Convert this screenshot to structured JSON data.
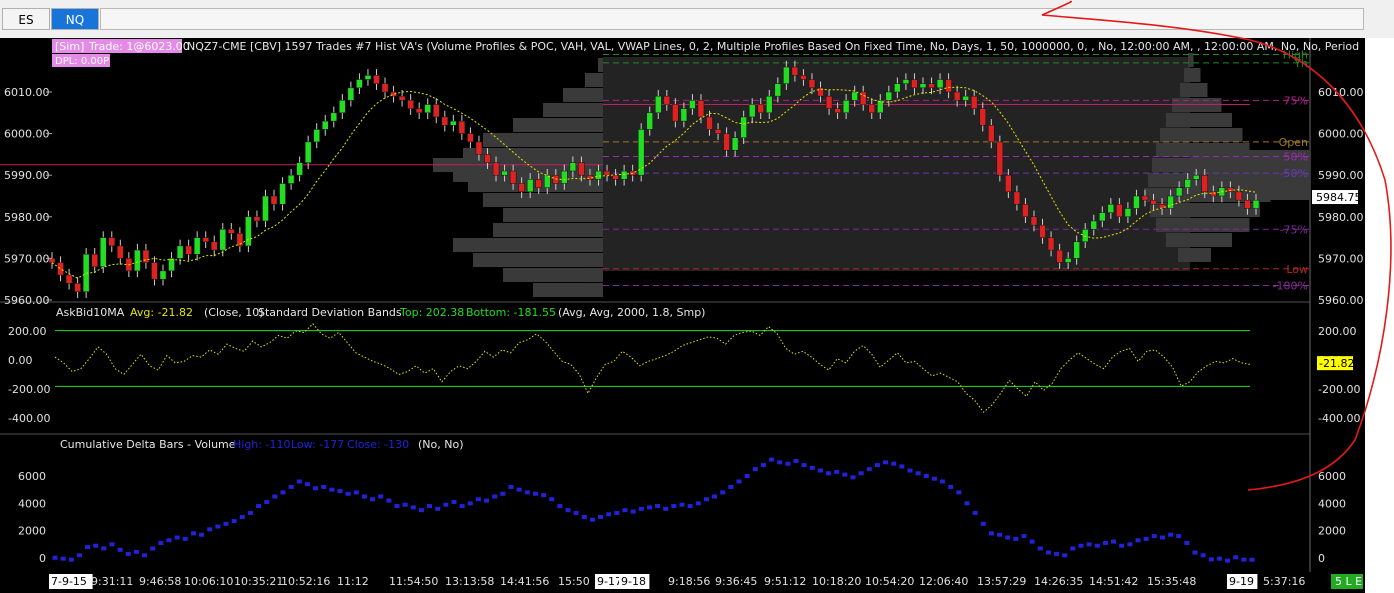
{
  "tabs": [
    {
      "label": "ES",
      "active": false
    },
    {
      "label": "NQ",
      "active": true
    }
  ],
  "colors": {
    "background": "#000000",
    "up": "#22dd22",
    "down": "#dd2222",
    "profile": "#3a3a3a",
    "vwap": "#e6e600",
    "askbid": "#e6e600",
    "bands": "#22dd22",
    "delta": "#2222dd",
    "annotation": "#e41a1a",
    "text": "#e0e0e0"
  },
  "header": {
    "sim_label": "[Sim]",
    "trade_label": "Trade: 1@6023.00",
    "info": "NQZ7-CME [CBV]  1597 Trades  #7 Hist VA's   (Volume Profiles & POC, VAH, VAL, VWAP Lines, 0, 2, Multiple Profiles Based On Fixed Time, No, Days, 1, 50, 1000000, 0, , No, 12:00:00 AM, , 12:00:00 AM, No, No, Period",
    "dpl_label": "DPL: 0.00P"
  },
  "price_panel": {
    "axis_labels": [
      "6010.00",
      "6000.00",
      "5990.00",
      "5980.00",
      "5970.00",
      "5960.00"
    ],
    "axis_values": [
      6010,
      6000,
      5990,
      5980,
      5970,
      5960
    ],
    "last_price": "5984.75",
    "level_labels": [
      {
        "text": "High",
        "value": 6019,
        "color": "#1e8c1e"
      },
      {
        "text": "Yh",
        "value": 6017,
        "color": "#1e8c1e"
      },
      {
        "text": "75%",
        "value": 6008,
        "color": "#b0208c"
      },
      {
        "text": "Open",
        "value": 5998,
        "color": "#a07828"
      },
      {
        "text": "50%",
        "value": 5994.5,
        "color": "#9a2ab0"
      },
      {
        "text": "-50%",
        "value": 5990.5,
        "color": "#6a3ab0"
      },
      {
        "text": "-75%",
        "value": 5977,
        "color": "#7a2a9a"
      },
      {
        "text": "Low",
        "value": 5967.5,
        "color": "#b02828"
      },
      {
        "text": "-100%",
        "value": 5963.5,
        "color": "#8a2a9a"
      }
    ]
  },
  "askbid_panel": {
    "name": "AskBid10MA",
    "avg_label": "Avg: -21.82",
    "params_a": "(Close, 10)",
    "bands_name": "Standard Deviation Bands",
    "top_label": "Top: 202.38",
    "bottom_label": "Bottom: -181.55",
    "params_b": "(Avg, Avg, 2000, 1.8, Smp)",
    "axis_labels": [
      "200.00",
      "0.00",
      "-200.00",
      "-400.00"
    ],
    "axis_values": [
      200,
      0,
      -200,
      -400
    ],
    "current_label": "-21.82",
    "current_value": -21.82,
    "top_value": 202.38,
    "bottom_value": -181.55
  },
  "delta_panel": {
    "name": "Cumulative Delta Bars - Volume",
    "high_label": "High: -110",
    "low_label": "Low: -177",
    "close_label": "Close: -130",
    "params": "(No, No)",
    "axis_labels": [
      "6000",
      "4000",
      "2000",
      "0"
    ],
    "axis_values": [
      6000,
      4000,
      2000,
      0
    ]
  },
  "time_axis": {
    "labels": [
      "7-9-15",
      "9:31:11",
      "9:46:58",
      "10:06:10",
      "10:35:21",
      "10:52:16",
      "11:12",
      "11:54:50",
      "13:13:58",
      "14:41:56",
      "15:50",
      "9-17",
      "9-18",
      "9:18:56",
      "9:36:45",
      "9:51:12",
      "10:18:20",
      "10:54:20",
      "12:06:40",
      "13:57:29",
      "14:26:35",
      "14:51:42",
      "15:35:48",
      "9-19",
      "5:37:16"
    ],
    "boxed": [
      "7-9-15",
      "9-17",
      "9-18",
      "9-19"
    ]
  },
  "status_badge": "5 L E",
  "chart_data": {
    "type": "candlestick",
    "price_series": {
      "name": "NQZ7-CME",
      "close": [
        5969,
        5966,
        5964,
        5962,
        5971,
        5968,
        5975,
        5973,
        5970,
        5967,
        5972,
        5969,
        5965,
        5967,
        5970,
        5973,
        5971,
        5975,
        5974,
        5972,
        5977,
        5976,
        5973,
        5980,
        5979,
        5985,
        5983,
        5988,
        5990,
        5993,
        5998,
        6001,
        6003,
        6005,
        6008,
        6011,
        6013,
        6014,
        6012,
        6010,
        6009,
        6008,
        6006,
        6005,
        6007,
        6004,
        6002,
        6003,
        6000,
        5998,
        5995,
        5993,
        5990,
        5991,
        5988,
        5986,
        5989,
        5987,
        5990,
        5988,
        5991,
        5993,
        5990,
        5989,
        5991,
        5990,
        5989,
        5991,
        5990,
        6001,
        6005,
        6009,
        6007,
        6003,
        6006,
        6008,
        6004,
        6001,
        6000,
        5996,
        5999,
        6004,
        6007,
        6005,
        6009,
        6012,
        6016,
        6014,
        6013,
        6011,
        6009,
        6006,
        6005,
        6008,
        6010,
        6007,
        6005,
        6008,
        6010,
        6012,
        6013,
        6011,
        6012,
        6011,
        6013,
        6010,
        6008,
        6009,
        6006,
        6002,
        5998,
        5990,
        5986,
        5983,
        5980,
        5978,
        5975,
        5972,
        5969,
        5970,
        5974,
        5977,
        5979,
        5981,
        5983,
        5980,
        5982,
        5985,
        5984,
        5983,
        5982,
        5985,
        5987,
        5989,
        5990,
        5986,
        5985,
        5987,
        5986,
        5984,
        5982,
        5984
      ]
    },
    "askbid_series": {
      "name": "AskBid10MA",
      "values": [
        20,
        -20,
        -80,
        -60,
        10,
        90,
        40,
        -60,
        -100,
        -30,
        40,
        -40,
        -70,
        30,
        -20,
        -10,
        30,
        20,
        70,
        40,
        110,
        80,
        60,
        130,
        90,
        120,
        170,
        150,
        200,
        190,
        250,
        180,
        150,
        190,
        120,
        50,
        20,
        -10,
        -30,
        -60,
        -100,
        -80,
        -40,
        -90,
        -60,
        -150,
        -80,
        -40,
        -60,
        -10,
        60,
        20,
        70,
        50,
        120,
        140,
        180,
        130,
        60,
        -10,
        -30,
        -100,
        -230,
        -120,
        -30,
        -10,
        60,
        20,
        -40,
        -10,
        10,
        30,
        60,
        100,
        120,
        140,
        160,
        150,
        110,
        170,
        190,
        200,
        170,
        230,
        180,
        80,
        40,
        60,
        20,
        -30,
        -70,
        10,
        -20,
        60,
        100,
        40,
        -50,
        0,
        50,
        -20,
        -10,
        -60,
        -110,
        -90,
        -120,
        -150,
        -230,
        -280,
        -360,
        -310,
        -230,
        -140,
        -200,
        -250,
        -150,
        -210,
        -160,
        -60,
        0,
        50,
        10,
        -30,
        -60,
        20,
        60,
        80,
        -10,
        60,
        70,
        20,
        -50,
        -180,
        -150,
        -80,
        -40,
        -10,
        -20,
        10,
        -20,
        -30
      ]
    },
    "delta_series": {
      "name": "Cumulative Delta Bars - Volume",
      "values": [
        20,
        -50,
        -120,
        200,
        800,
        900,
        700,
        1000,
        600,
        300,
        450,
        200,
        700,
        1100,
        1300,
        1500,
        1400,
        1800,
        1700,
        2100,
        2300,
        2500,
        2700,
        3000,
        3300,
        3800,
        4100,
        4500,
        4800,
        5200,
        5600,
        5400,
        5100,
        5200,
        5000,
        4900,
        4700,
        4800,
        4500,
        4300,
        4500,
        4200,
        3800,
        3900,
        3700,
        3500,
        3800,
        3600,
        3900,
        4100,
        3800,
        4000,
        4300,
        4200,
        4500,
        4700,
        5200,
        5000,
        4800,
        4700,
        4600,
        4300,
        3800,
        3500,
        3300,
        3000,
        2800,
        3000,
        3200,
        3300,
        3500,
        3400,
        3600,
        3700,
        3800,
        3600,
        3800,
        3900,
        3800,
        4000,
        4300,
        4500,
        4800,
        5200,
        5600,
        6000,
        6500,
        6800,
        7200,
        7000,
        6900,
        7100,
        6800,
        6600,
        6400,
        6200,
        6300,
        6100,
        5900,
        6200,
        6500,
        6800,
        7000,
        6900,
        6700,
        6400,
        6200,
        6000,
        5800,
        5600,
        5200,
        4800,
        4000,
        3300,
        2500,
        1800,
        1700,
        1500,
        1400,
        1600,
        1200,
        700,
        400,
        300,
        200,
        700,
        900,
        1000,
        900,
        1100,
        1200,
        900,
        1000,
        1300,
        1400,
        1600,
        1500,
        1700,
        1600,
        1100,
        400,
        200,
        -100,
        -50,
        -200,
        50,
        -120,
        -130
      ]
    }
  }
}
